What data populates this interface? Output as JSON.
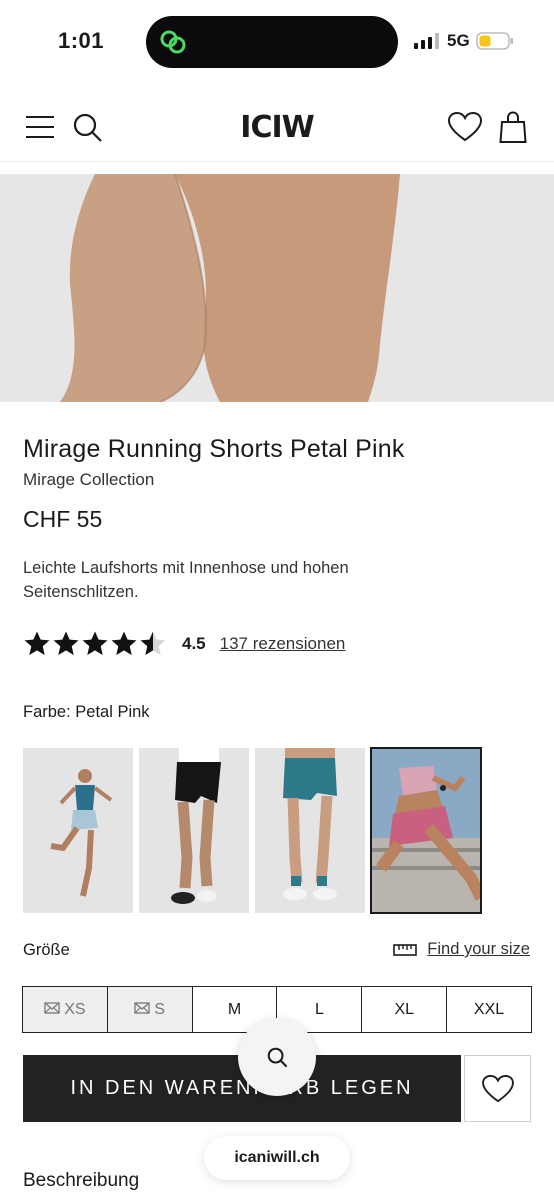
{
  "status_bar": {
    "time": "1:01",
    "network": "5G"
  },
  "header": {
    "logo": "ICIW"
  },
  "product": {
    "title": "Mirage Running Shorts Petal Pink",
    "collection": "Mirage Collection",
    "price": "CHF 55",
    "description": "Leichte Laufshorts mit Innenhose und hohen Seitenschlitzen.",
    "rating": 4.5,
    "rating_label": "4.5",
    "reviews": "137 rezensionen"
  },
  "color": {
    "label": "Farbe: Petal Pink",
    "swatch_count": 4,
    "selected_index": 3
  },
  "size": {
    "label": "Größe",
    "find_size": "Find your size",
    "options": [
      {
        "label": "XS",
        "available": false
      },
      {
        "label": "S",
        "available": false
      },
      {
        "label": "M",
        "available": true
      },
      {
        "label": "L",
        "available": true
      },
      {
        "label": "XL",
        "available": true
      },
      {
        "label": "XXL",
        "available": true
      }
    ]
  },
  "actions": {
    "add_to_cart": "IN DEN WARENKORB LEGEN"
  },
  "browser": {
    "url": "icaniwill.ch"
  },
  "sections": {
    "description_title": "Beschreibung"
  },
  "colors": {
    "island_icon": "#4cd964",
    "battery": "#f5c518",
    "button": "#222222",
    "skin": "#c69a7b"
  }
}
